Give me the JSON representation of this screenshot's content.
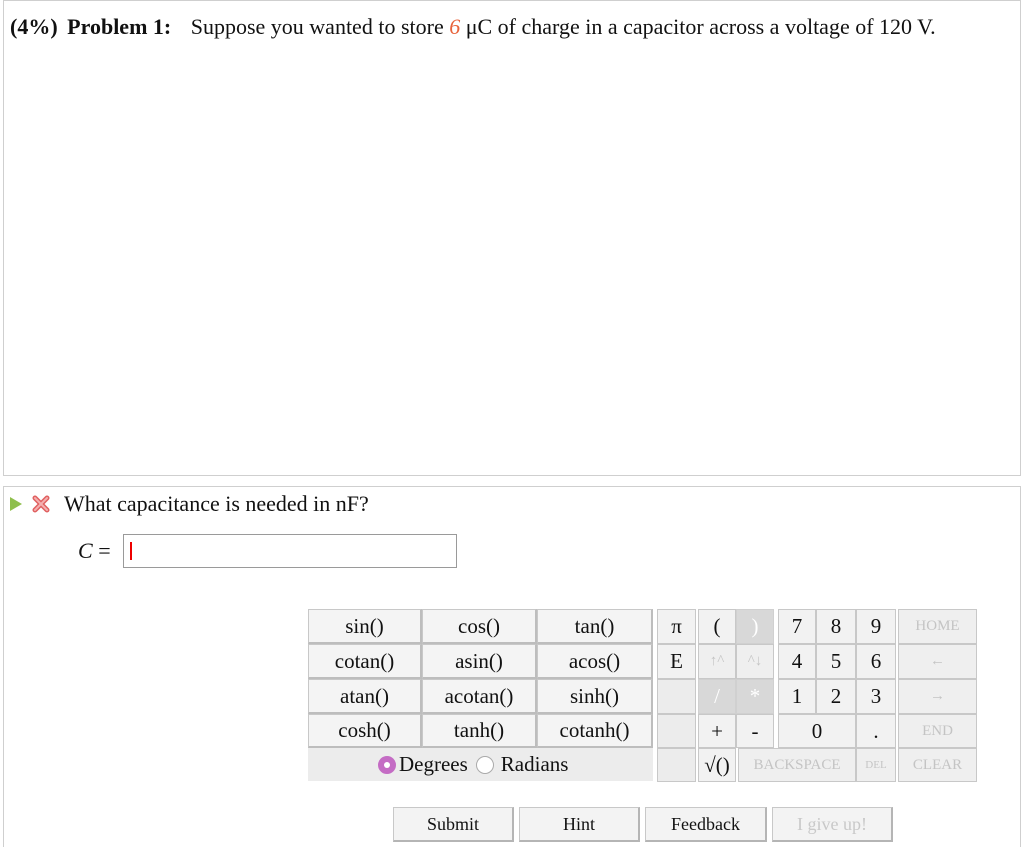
{
  "problem": {
    "weight": "(4%)",
    "label": "Problem 1:",
    "text_before": "Suppose you wanted to store",
    "value": "6",
    "text_after": "μC of charge in a capacitor across a voltage of 120 V."
  },
  "part": {
    "question": "What capacitance is needed in nF?",
    "answer_var": "C",
    "answer_eq": "=",
    "answer_value": ""
  },
  "keypad": {
    "functions": [
      [
        "sin()",
        "cos()",
        "tan()"
      ],
      [
        "cotan()",
        "asin()",
        "acos()"
      ],
      [
        "atan()",
        "acotan()",
        "sinh()"
      ],
      [
        "cosh()",
        "tanh()",
        "cotanh()"
      ]
    ],
    "symbols": [
      "π",
      "E"
    ],
    "paren_open": "(",
    "paren_close": ")",
    "up_arrow": "↑^",
    "down_arrow": "^↓",
    "divide": "/",
    "multiply": "*",
    "plus": "+",
    "minus": "-",
    "sqrt": "√()",
    "digits": [
      [
        "7",
        "8",
        "9"
      ],
      [
        "4",
        "5",
        "6"
      ],
      [
        "1",
        "2",
        "3"
      ]
    ],
    "zero": "0",
    "dot": ".",
    "home": "HOME",
    "left": "←",
    "right": "→",
    "end": "END",
    "backspace": "BACKSPACE",
    "del": "DEL",
    "clear": "CLEAR",
    "degrees": "Degrees",
    "radians": "Radians",
    "mode_selected": "Degrees"
  },
  "buttons": {
    "submit": "Submit",
    "hint": "Hint",
    "feedback": "Feedback",
    "give_up": "I give up!"
  }
}
